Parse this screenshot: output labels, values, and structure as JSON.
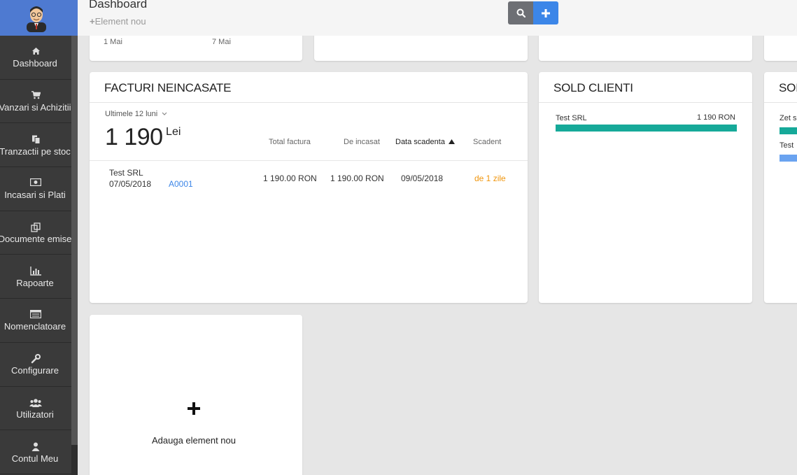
{
  "header": {
    "title": "Dashboard",
    "new_element": "Element nou"
  },
  "sidebar": {
    "items": [
      {
        "label": "Dashboard",
        "icon": "home-icon"
      },
      {
        "label": "Vanzari si Achizitii",
        "icon": "cart-icon"
      },
      {
        "label": "Tranzactii pe stoc",
        "icon": "copy-icon"
      },
      {
        "label": "Incasari si Plati",
        "icon": "money-icon"
      },
      {
        "label": "Documente emise",
        "icon": "documents-icon"
      },
      {
        "label": "Rapoarte",
        "icon": "bar-chart-icon"
      },
      {
        "label": "Nomenclatoare",
        "icon": "list-icon"
      },
      {
        "label": "Configurare",
        "icon": "wrench-icon"
      },
      {
        "label": "Utilizatori",
        "icon": "users-icon"
      },
      {
        "label": "Contul Meu",
        "icon": "user-icon"
      }
    ]
  },
  "top_card": {
    "date_start": "1 Mai",
    "date_end": "7 Mai"
  },
  "facturi": {
    "title": "FACTURI NEINCASATE",
    "period": "Ultimele 12 luni",
    "total": "1 190",
    "currency": "Lei",
    "columns": {
      "total_factura": "Total factura",
      "de_incasat": "De incasat",
      "data_scadenta": "Data scadenta",
      "scadent": "Scadent"
    },
    "rows": [
      {
        "client": "Test SRL",
        "date": "07/05/2018",
        "invoice": "A0001",
        "total": "1 190.00 RON",
        "due_amount": "1 190.00 RON",
        "due_date": "09/05/2018",
        "overdue": "de 1 zile"
      }
    ]
  },
  "sold_clienti": {
    "title": "SOLD CLIENTI",
    "client": "Test SRL",
    "amount": "1 190 RON",
    "fill": 1.0,
    "bar_color": "#16a999"
  },
  "partial_card": {
    "title": "SOI",
    "row1": "Zet s",
    "row2": "Test",
    "bar1_color": "#16a999",
    "bar2_color": "#6aa3f0"
  },
  "add_card": {
    "label": "Adauga element nou"
  }
}
